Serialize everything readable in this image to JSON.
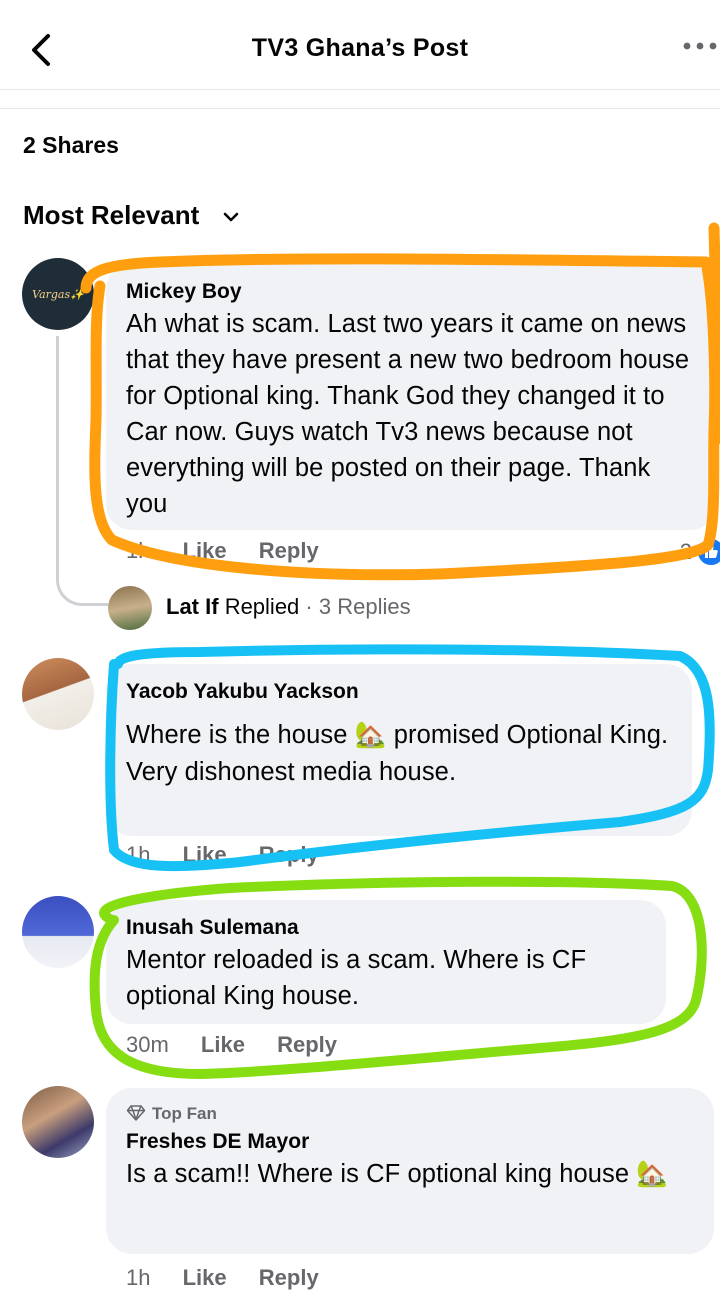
{
  "header": {
    "title": "TV3 Ghana’s Post",
    "back_icon": "chevron-left-icon",
    "more_icon": "more-horizontal-icon"
  },
  "shares_label": "2 Shares",
  "sort_label": "Most Relevant",
  "comments": [
    {
      "avatar_text": "Vargas✨",
      "author": "Mickey Boy",
      "text": "Ah what is scam. Last two years it came on news that they have present a new two bedroom house for Optional king. Thank God they changed it to Car now. Guys watch Tv3 news because not everything will be posted on their page. Thank you",
      "time": "1h",
      "like_label": "Like",
      "reply_label": "Reply",
      "reaction_count": "2",
      "reply_summary": {
        "name": "Lat If",
        "replied": "Replied",
        "sep": " · ",
        "count": "3 Replies"
      }
    },
    {
      "author": "Yacob Yakubu Yackson",
      "text_line1": "Where is the house 🏡 promised Optional King.",
      "text_line2": "Very dishonest media house.",
      "time": "1h",
      "like_label": "Like",
      "reply_label": "Reply"
    },
    {
      "author": "Inusah Sulemana",
      "text": "Mentor reloaded is a scam. Where is CF optional King house.",
      "time": "30m",
      "like_label": "Like",
      "reply_label": "Reply"
    },
    {
      "badge": "Top Fan",
      "author": "Freshes DE Mayor",
      "text": "Is a scam!! Where is CF optional king house 🏡",
      "time": "1h",
      "like_label": "Like",
      "reply_label": "Reply"
    }
  ],
  "colors": {
    "bubble": "#f0f2f5",
    "secondary_text": "#65676b",
    "like_blue": "#1877f2",
    "annotation_orange": "#ff9f0f",
    "annotation_blue": "#17c1f5",
    "annotation_green": "#86dd12"
  }
}
